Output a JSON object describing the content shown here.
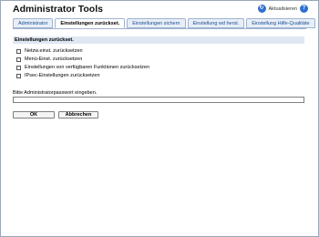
{
  "header": {
    "title": "Administrator Tools",
    "refresh_label": "Aktualisieren"
  },
  "tabs": [
    {
      "label": "Administrator"
    },
    {
      "label": "Einstellungen zurückset."
    },
    {
      "label": "Einstellungen sichern"
    },
    {
      "label": "Einstellung wd herst."
    },
    {
      "label": "Einstellung Hilfe-Qualitäte"
    }
  ],
  "section": {
    "title": "Einstellungen zurückset."
  },
  "options": [
    {
      "label": "Netzw.einst. zurücksetzen"
    },
    {
      "label": "Menü-Einst. zurücksetzen"
    },
    {
      "label": "Einstellungen von verfügbaren Funktionen zurücksetzen"
    },
    {
      "label": "IPsec-Einstellungen zurücksetzen"
    }
  ],
  "password": {
    "label": "Bitte Administratorpasswort eingeben.",
    "value": ""
  },
  "buttons": {
    "ok": "OK",
    "cancel": "Abbrechen"
  }
}
